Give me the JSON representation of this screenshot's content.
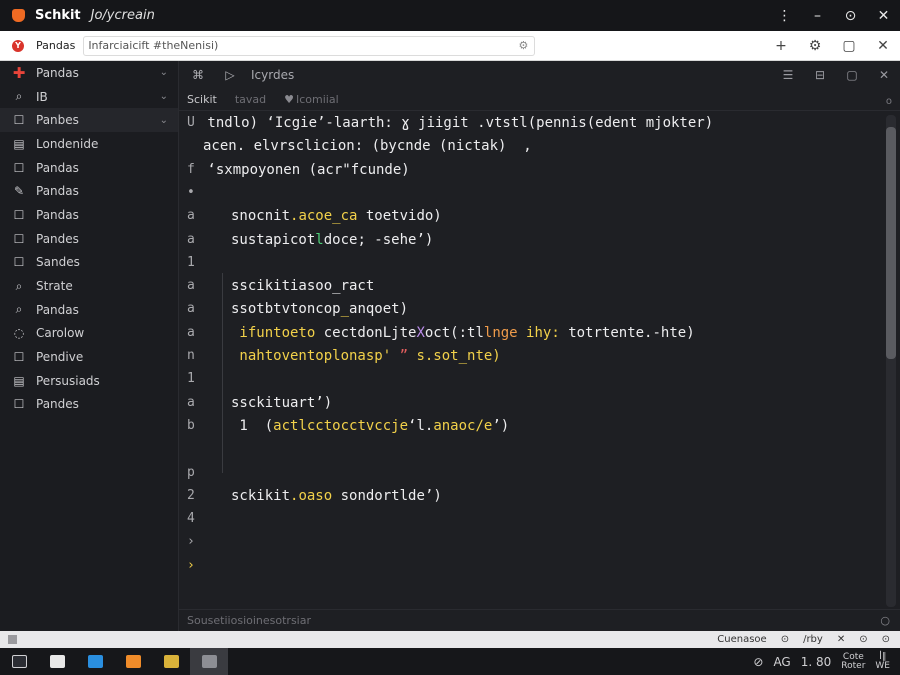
{
  "titlebar": {
    "app_name": "Schkit",
    "document": "Jo/ycreain",
    "controls": [
      "⋮",
      "–",
      "⊙",
      "✕"
    ]
  },
  "addressbar": {
    "tab_label": "Pandas",
    "address": "Infarciaicift #theNenisi)",
    "actions": [
      "+",
      "⚙",
      "▢",
      "✕"
    ]
  },
  "sidebar": {
    "items": [
      {
        "icon": "plus-icon",
        "label": "Pandas",
        "chevron": true
      },
      {
        "icon": "search-icon",
        "label": "IB",
        "chevron": true
      },
      {
        "icon": "square-icon",
        "label": "Panbes",
        "chevron": true,
        "active": true
      },
      {
        "icon": "doc-icon",
        "label": "Londenide"
      },
      {
        "icon": "square-icon",
        "label": "Pandas"
      },
      {
        "icon": "pen-icon",
        "label": "Pandas"
      },
      {
        "icon": "square-icon",
        "label": "Pandas"
      },
      {
        "icon": "square-icon",
        "label": "Pandes"
      },
      {
        "icon": "square-icon",
        "label": "Sandes"
      },
      {
        "icon": "search-icon",
        "label": "Strate"
      },
      {
        "icon": "search-icon",
        "label": "Pandas"
      },
      {
        "icon": "circle-icon",
        "label": "Carolow"
      },
      {
        "icon": "square-icon",
        "label": "Pendive"
      },
      {
        "icon": "doc-icon",
        "label": "Persusiads"
      },
      {
        "icon": "square-icon",
        "label": "Pandes"
      }
    ]
  },
  "editor": {
    "toolbar_title": "Icyrdes",
    "tabs": [
      {
        "label": "Scikit",
        "dim": false
      },
      {
        "label": "tavad",
        "dim": true
      },
      {
        "label": "Icomiial",
        "dim": true
      }
    ],
    "status_text": "Sousetiiosioinesotrsiar"
  },
  "code_lines": [
    {
      "ln": "U",
      "text": " tndlo) ‘Icgie’-laarth: ɣ jiigit .vtstl(pennis(edent mjokter)",
      "color": "white",
      "indent": 0
    },
    {
      "ln": "",
      "text": "acen. elvrsclicion: (bycnde (nictak)  ,",
      "color": "white",
      "indent": 1
    },
    {
      "ln": "f",
      "text": " ‘sxmpoyonen (acr\"fcunde)",
      "color": "white",
      "indent": 0
    },
    {
      "ln": "•",
      "text": "",
      "color": "white",
      "indent": 0
    },
    {
      "ln": "a",
      "text": "snocnit.acoe_ca toetvido)",
      "color": "mix1",
      "indent": 2
    },
    {
      "ln": "a",
      "text": "sustapicotldoce; -sehe’)",
      "color": "mix2",
      "indent": 2
    },
    {
      "ln": "1",
      "text": "",
      "color": "white",
      "indent": 0
    },
    {
      "ln": "a",
      "text": "sscikitiasoo_ract",
      "color": "white",
      "indent": 2
    },
    {
      "ln": "a",
      "text": "ssotbtvtoncop_anqoet)",
      "color": "mix3",
      "indent": 2
    },
    {
      "ln": "a",
      "text": " ifuntoeto cectdonLjteXoct(:tllnge ihy: totrtente.-hte)",
      "color": "mix4",
      "indent": 2
    },
    {
      "ln": "n",
      "text": " nahtoventoplonasp' ” s.sot_nte)",
      "color": "mix5",
      "indent": 2
    },
    {
      "ln": "1",
      "text": "",
      "color": "white",
      "indent": 0
    },
    {
      "ln": "a",
      "text": "ssckituart’)",
      "color": "white",
      "indent": 2
    },
    {
      "ln": "b",
      "text": " 1  (actlcctocctvccje‘l.anaoc/e’)",
      "color": "mix6",
      "indent": 2
    },
    {
      "ln": "",
      "text": "",
      "color": "white",
      "indent": 0
    },
    {
      "ln": "p",
      "text": "",
      "color": "white",
      "indent": 0
    },
    {
      "ln": "2",
      "text": "sckikit.oaso sondortlde’)",
      "color": "mix7",
      "indent": 2
    },
    {
      "ln": "4",
      "text": "",
      "color": "white",
      "indent": 0
    },
    {
      "ln": "›",
      "text": "",
      "color": "white",
      "indent": 0
    },
    {
      "ln": "›",
      "text": "",
      "color": "yellow",
      "indent": 0
    }
  ],
  "statusbar": {
    "right_items": [
      "Cuenasoe",
      "⊙",
      "/rby",
      "✕",
      "⊙",
      "⊙"
    ]
  },
  "taskbar": {
    "apps": [
      {
        "icon": "terminal-icon",
        "color": "#2b2d33"
      },
      {
        "icon": "window-icon",
        "color": "#e8e8e8"
      },
      {
        "icon": "vscode-icon",
        "color": "#2a8fe0"
      },
      {
        "icon": "orange-app-icon",
        "color": "#f08c2a"
      },
      {
        "icon": "yellow-app-icon",
        "color": "#d9b23a"
      },
      {
        "icon": "grid-app-icon",
        "color": "#8d8e94",
        "active": true
      }
    ],
    "tray": [
      "⊘",
      "AG",
      "1. 80"
    ],
    "clock_top": "Cote",
    "clock_bottom": "Roter",
    "corner_top": "ꟾ∥",
    "corner_bottom": "WE"
  }
}
